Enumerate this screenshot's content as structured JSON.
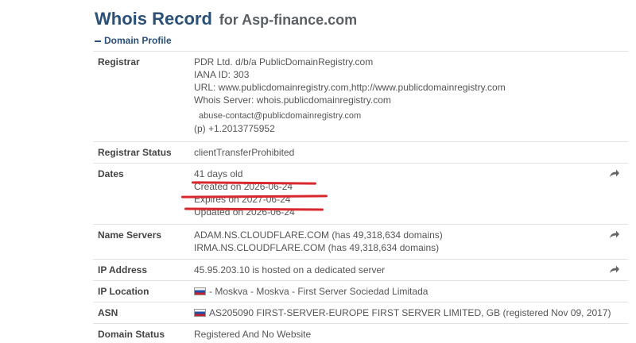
{
  "header": {
    "title": "Whois Record",
    "subtitle": "for Asp-finance.com"
  },
  "section": {
    "label": "Domain Profile"
  },
  "rows": [
    {
      "label": "Registrar",
      "lines": [
        "PDR Ltd. d/b/a PublicDomainRegistry.com",
        "IANA ID: 303",
        "URL: www.publicdomainregistry.com,http://www.publicdomainregistry.com",
        "Whois Server: whois.publicdomainregistry.com",
        "abuse-contact@publicdomainregistry.com",
        "(p) +1.2013775952"
      ]
    },
    {
      "label": "Registrar Status",
      "lines": [
        "clientTransferProhibited"
      ]
    },
    {
      "label": "Dates",
      "lines": [
        "41 days old",
        "Created on 2026-06-24",
        "Expires on 2027-06-24",
        "Updated on 2026-06-24"
      ]
    },
    {
      "label": "Name Servers",
      "lines": [
        "ADAM.NS.CLOUDFLARE.COM (has 49,318,634 domains)",
        "IRMA.NS.CLOUDFLARE.COM (has 49,318,634 domains)"
      ]
    },
    {
      "label": "IP Address",
      "lines": [
        "45.95.203.10 is hosted on a dedicated server"
      ]
    },
    {
      "label": "IP Location",
      "lines": [
        "- Moskva - Moskva - First Server Sociedad Limitada"
      ]
    },
    {
      "label": "ASN",
      "lines": [
        "AS205090 FIRST-SERVER-EUROPE FIRST SERVER LIMITED, GB (registered Nov 09, 2017)"
      ]
    },
    {
      "label": "Domain Status",
      "lines": [
        "Registered And No Website"
      ]
    }
  ],
  "icons": {
    "share": "share-arrow-icon",
    "flag": "russia-flag-icon"
  },
  "colors": {
    "title": "#2a5078",
    "annotation": "#d9272e"
  }
}
